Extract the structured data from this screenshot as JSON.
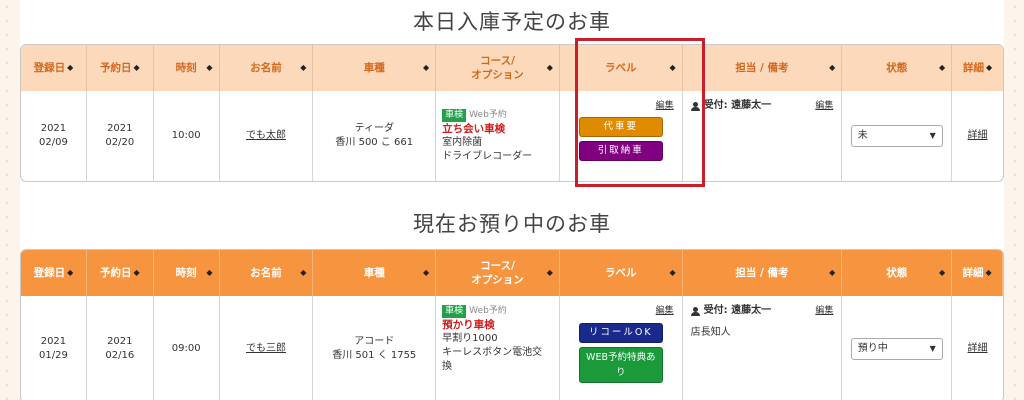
{
  "sections": [
    {
      "title": "本日入庫予定のお車",
      "headers": [
        "登録日",
        "予約日",
        "時刻",
        "お名前",
        "車種",
        "コース/",
        "オプション",
        "ラベル",
        "担当 / 備考",
        "状態",
        "詳細"
      ],
      "row": {
        "reg_year": "2021",
        "reg_date": "02/09",
        "res_year": "2021",
        "res_date": "02/20",
        "time": "10:00",
        "name": "でも太郎",
        "car_model": "ティーダ",
        "car_plate": "香川 500 こ 661",
        "badge": "車検",
        "web_tag": "Web予約",
        "course_name": "立ち会い車検",
        "options": [
          "室内除菌",
          "ドライブレコーダー"
        ],
        "edit_label": "編集",
        "labels": [
          {
            "text": "代車要",
            "color": "#e08a00"
          },
          {
            "text": "引取納車",
            "color": "#800080"
          }
        ],
        "staff": "受付: 遠藤太一",
        "staff_edit": "編集",
        "note": "",
        "status": "未",
        "detail": "詳細"
      }
    },
    {
      "title": "現在お預り中のお車",
      "headers": [
        "登録日",
        "予約日",
        "時刻",
        "お名前",
        "車種",
        "コース/",
        "オプション",
        "ラベル",
        "担当 / 備考",
        "状態",
        "詳細"
      ],
      "row": {
        "reg_year": "2021",
        "reg_date": "01/29",
        "res_year": "2021",
        "res_date": "02/16",
        "time": "09:00",
        "name": "でも三郎",
        "car_model": "アコード",
        "car_plate": "香川 501 く 1755",
        "badge": "車検",
        "web_tag": "Web予約",
        "course_name": "預かり車検",
        "options": [
          "早割り1000",
          "キーレスボタン電池交",
          "換"
        ],
        "edit_label": "編集",
        "labels": [
          {
            "text": "リコールOK",
            "color": "#1a2a8c"
          },
          {
            "text": "WEB予約特典あり",
            "color": "#1a9a3a"
          }
        ],
        "staff": "受付: 遠藤太一",
        "staff_edit": "編集",
        "note": "店長知人",
        "status": "預り中",
        "detail": "詳細"
      }
    }
  ],
  "colors": {
    "header1_bg": "#fcd9bb",
    "header2_bg": "#f7943f",
    "highlight": "#c8202b"
  }
}
